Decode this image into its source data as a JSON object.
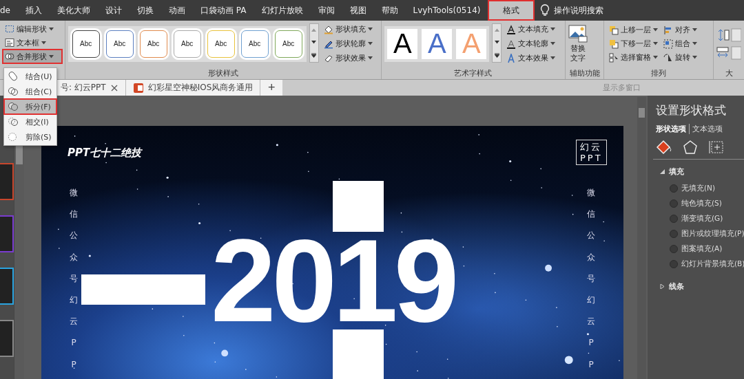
{
  "menu_tabs": [
    {
      "label": "de",
      "selected": false
    },
    {
      "label": "插入",
      "selected": false
    },
    {
      "label": "美化大师",
      "selected": false
    },
    {
      "label": "设计",
      "selected": false
    },
    {
      "label": "切换",
      "selected": false
    },
    {
      "label": "动画",
      "selected": false
    },
    {
      "label": "口袋动画 PA",
      "selected": false
    },
    {
      "label": "幻灯片放映",
      "selected": false
    },
    {
      "label": "审阅",
      "selected": false
    },
    {
      "label": "视图",
      "selected": false
    },
    {
      "label": "帮助",
      "selected": false
    },
    {
      "label": "LvyhTools(0514)",
      "selected": false
    },
    {
      "label": "格式",
      "selected": true
    }
  ],
  "tell_me": {
    "label": "操作说明搜索"
  },
  "ribbon": {
    "insert_shapes": [
      {
        "label": "编辑形状",
        "kind": "edit",
        "selected": false
      },
      {
        "label": "文本框",
        "kind": "textbox",
        "selected": false
      },
      {
        "label": "合并形状",
        "kind": "merge",
        "selected": true
      }
    ],
    "shape_styles": {
      "label": "形状样式",
      "samples": [
        {
          "text": "Abc",
          "color": "#444444"
        },
        {
          "text": "Abc",
          "color": "#5b7fc0"
        },
        {
          "text": "Abc",
          "color": "#e08a4c"
        },
        {
          "text": "Abc",
          "color": "#a9a9a9"
        },
        {
          "text": "Abc",
          "color": "#e8c23c"
        },
        {
          "text": "Abc",
          "color": "#6fa0d0"
        },
        {
          "text": "Abc",
          "color": "#7fa85a"
        }
      ],
      "commands": [
        {
          "label": "形状填充",
          "kind": "fill"
        },
        {
          "label": "形状轮廓",
          "kind": "outline"
        },
        {
          "label": "形状效果",
          "kind": "effect"
        }
      ]
    },
    "wordart_styles": {
      "label": "艺术字样式",
      "samples": [
        {
          "text": "A",
          "color": "#000000"
        },
        {
          "text": "A",
          "color": "#4a6fc8"
        },
        {
          "text": "A",
          "color": "#f4a070"
        }
      ],
      "commands": [
        {
          "label": "文本填充",
          "kind": "fill"
        },
        {
          "label": "文本轮廓",
          "kind": "outline"
        },
        {
          "label": "文本效果",
          "kind": "effect"
        }
      ]
    },
    "accessibility": {
      "label": "辅助功能",
      "button": "替换文字"
    },
    "arrange": {
      "label": "排列",
      "commands": [
        {
          "label": "上移一层",
          "kind": "forward"
        },
        {
          "label": "对齐",
          "kind": "align"
        },
        {
          "label": "下移一层",
          "kind": "backward"
        },
        {
          "label": "组合",
          "kind": "group"
        },
        {
          "label": "选择窗格",
          "kind": "pane"
        },
        {
          "label": "旋转",
          "kind": "rotate"
        }
      ]
    },
    "size": {
      "label": "大"
    }
  },
  "merge_menu": [
    {
      "label": "结合(U)",
      "kind": "union",
      "selected": false
    },
    {
      "label": "组合(C)",
      "kind": "combine",
      "selected": false
    },
    {
      "label": "拆分(F)",
      "kind": "fragment",
      "selected": true
    },
    {
      "label": "相交(I)",
      "kind": "intersect",
      "selected": false
    },
    {
      "label": "剪除(S)",
      "kind": "subtract",
      "selected": false
    }
  ],
  "doc_tabs": [
    {
      "label": "号: 幻云PPT",
      "closable": true,
      "has_icon": false
    },
    {
      "label": "幻彩星空神秘IOS风商务通用",
      "closable": false,
      "has_icon": true
    }
  ],
  "new_tab": "+",
  "show_windows": "显示多窗口",
  "slide": {
    "title": "PPT七十二绝技",
    "logo": [
      "幻云",
      "PPT"
    ],
    "side_left": "微信公众号幻云PP",
    "side_right": "微信公众号幻云PP",
    "year": "2019"
  },
  "format_pane": {
    "title": "设置形状格式",
    "tabs": [
      {
        "label": "形状选项",
        "selected": true
      },
      {
        "label": "文本选项",
        "selected": false
      }
    ],
    "icon_tabs": [
      {
        "kind": "fill",
        "selected": true
      },
      {
        "kind": "effects",
        "selected": false
      },
      {
        "kind": "size",
        "selected": false
      }
    ],
    "sections": [
      {
        "label": "填充",
        "expanded": true,
        "options": [
          {
            "label": "无填充(N)",
            "selected": false
          },
          {
            "label": "纯色填充(S)",
            "selected": false
          },
          {
            "label": "渐变填充(G)",
            "selected": false
          },
          {
            "label": "图片或纹理填充(P)",
            "selected": false
          },
          {
            "label": "图案填充(A)",
            "selected": false
          },
          {
            "label": "幻灯片背景填充(B)",
            "selected": false
          }
        ]
      },
      {
        "label": "线条",
        "expanded": false
      }
    ]
  }
}
